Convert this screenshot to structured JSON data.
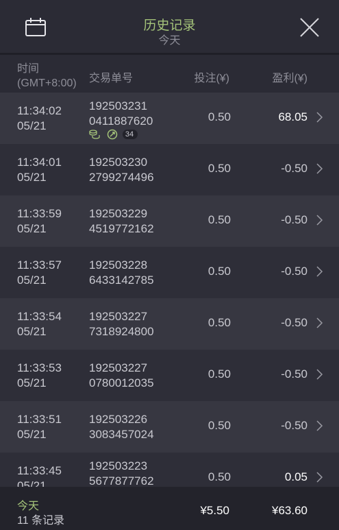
{
  "header": {
    "title": "历史记录",
    "subtitle": "今天",
    "calendar_icon": "calendar-icon",
    "close_icon": "close-icon"
  },
  "columns": {
    "time_line1": "时间",
    "time_line2": "(GMT+8:00)",
    "order": "交易单号",
    "bet": "投注(¥)",
    "profit": "盈利(¥)"
  },
  "rows": [
    {
      "time": "11:34:02",
      "date": "05/21",
      "order1": "192503231",
      "order2": "0411887620",
      "bet": "0.50",
      "profit": "68.05",
      "badge_count": "34"
    },
    {
      "time": "11:34:01",
      "date": "05/21",
      "order1": "192503230",
      "order2": "2799274496",
      "bet": "0.50",
      "profit": "-0.50"
    },
    {
      "time": "11:33:59",
      "date": "05/21",
      "order1": "192503229",
      "order2": "4519772162",
      "bet": "0.50",
      "profit": "-0.50"
    },
    {
      "time": "11:33:57",
      "date": "05/21",
      "order1": "192503228",
      "order2": "6433142785",
      "bet": "0.50",
      "profit": "-0.50"
    },
    {
      "time": "11:33:54",
      "date": "05/21",
      "order1": "192503227",
      "order2": "7318924800",
      "bet": "0.50",
      "profit": "-0.50"
    },
    {
      "time": "11:33:53",
      "date": "05/21",
      "order1": "192503227",
      "order2": "0780012035",
      "bet": "0.50",
      "profit": "-0.50"
    },
    {
      "time": "11:33:51",
      "date": "05/21",
      "order1": "192503226",
      "order2": "3083457024",
      "bet": "0.50",
      "profit": "-0.50"
    },
    {
      "time": "11:33:45",
      "date": "05/21",
      "order1": "192503223",
      "order2": "5677877762",
      "bet": "0.50",
      "profit": "0.05"
    }
  ],
  "footer": {
    "label": "今天",
    "count": "11 条记录",
    "total_bet": "¥5.50",
    "total_profit": "¥63.60"
  },
  "colors": {
    "accent": "#a5c47a",
    "background": "#2e2e38",
    "row_alt": "#373741"
  }
}
